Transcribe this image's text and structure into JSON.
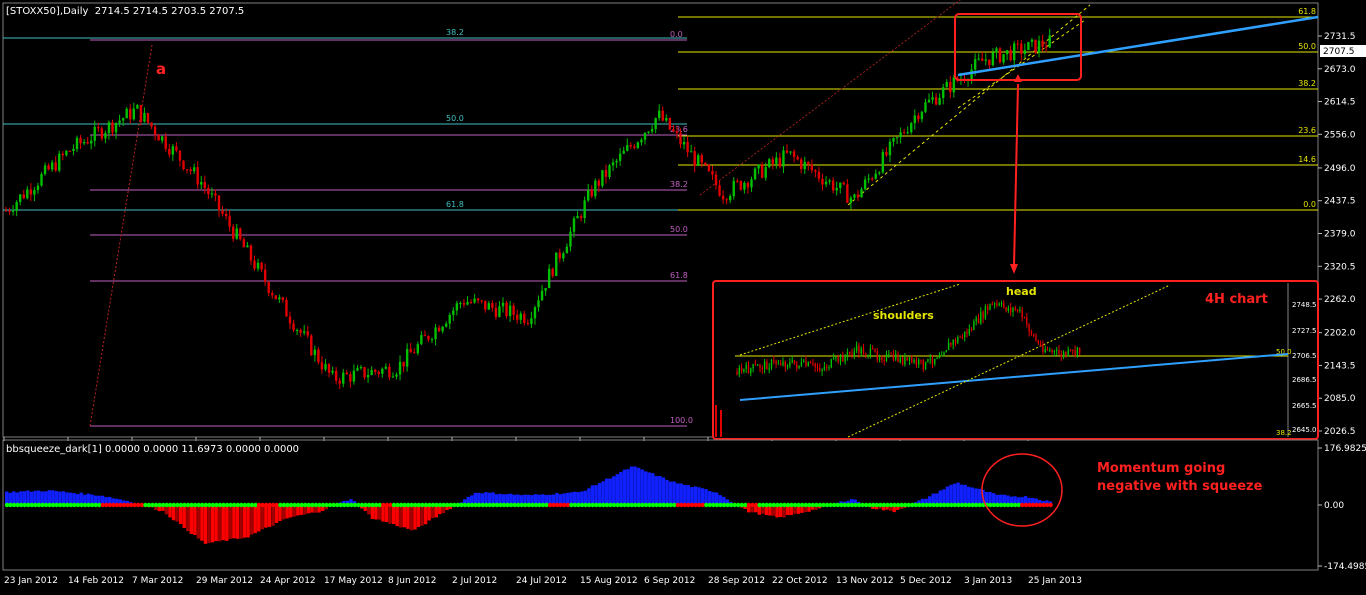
{
  "header": {
    "symbol_text": "[STOXX50],Daily",
    "ohlc_text": "2714.5 2714.5 2703.5 2707.5"
  },
  "indicator_header": {
    "text": "bbsqueeze_dark[1] 0.0000 0.0000 11.6973 0.0000 0.0000"
  },
  "colors": {
    "background": "#000000",
    "bull": "#00c000",
    "bear": "#e00000",
    "fib_yellow": "#e6e600",
    "fib_violet": "#c060c0",
    "fib_cyan": "#40c0c0",
    "trendline": "#30a0ff",
    "annotation_red": "#ff2020",
    "momentum_blue": "#1020ff",
    "momentum_red": "#ff0000",
    "squeeze_green": "#00ff00",
    "squeeze_red": "#ff0000"
  },
  "chart_data": [
    {
      "type": "candlestick",
      "title": "[STOXX50],Daily",
      "ylim": [
        2000,
        2800
      ],
      "y_ticks": [
        "2731.5",
        "2673.0",
        "2614.5",
        "2556.0",
        "2496.0",
        "2437.5",
        "2379.0",
        "2320.5",
        "2262.0",
        "2202.0",
        "2143.5",
        "2085.0",
        "2026.5"
      ],
      "current_price": "2707.5",
      "x_ticks": [
        "23 Jan 2012",
        "14 Feb 2012",
        "7 Mar 2012",
        "29 Mar 2012",
        "24 Apr 2012",
        "17 May 2012",
        "8 Jun 2012",
        "2 Jul 2012",
        "24 Jul 2012",
        "15 Aug 2012",
        "6 Sep 2012",
        "28 Sep 2012",
        "22 Oct 2012",
        "13 Nov 2012",
        "5 Dec 2012",
        "3 Jan 2013",
        "25 Jan 2013"
      ],
      "close_path": [
        [
          "23 Jan 2012",
          2420
        ],
        [
          "14 Feb 2012",
          2530
        ],
        [
          "7 Mar 2012",
          2600
        ],
        [
          "29 Mar 2012",
          2470
        ],
        [
          "24 Apr 2012",
          2290
        ],
        [
          "17 May 2012",
          2120
        ],
        [
          "8 Jun 2012",
          2140
        ],
        [
          "2 Jul 2012",
          2260
        ],
        [
          "24 Jul 2012",
          2230
        ],
        [
          "15 Aug 2012",
          2460
        ],
        [
          "6 Sep 2012",
          2590
        ],
        [
          "28 Sep 2012",
          2450
        ],
        [
          "22 Oct 2012",
          2520
        ],
        [
          "13 Nov 2012",
          2440
        ],
        [
          "5 Dec 2012",
          2600
        ],
        [
          "3 Jan 2013",
          2690
        ],
        [
          "25 Jan 2013",
          2720
        ]
      ],
      "fib_levels_right": [
        "61.8",
        "50.0",
        "38.2",
        "23.6",
        "14.6",
        "0.0"
      ],
      "fib_levels_violet": [
        "0.0",
        "23.6",
        "38.2",
        "50.0",
        "61.8",
        "100.0"
      ],
      "fib_levels_cyan": [
        "38.2",
        "50.0",
        "61.8"
      ],
      "annotations": {
        "wave_label": "a",
        "momentum_note": "Momentum going negative with squeeze"
      }
    },
    {
      "type": "candlestick",
      "title": "4H chart",
      "y_ticks": [
        "2748.5",
        "2727.5",
        "2706.5",
        "2686.5",
        "2665.5",
        "2645.0"
      ],
      "current_price": "2706.5",
      "fib_labels": [
        "50.0",
        "38.2"
      ],
      "annotations": [
        "head",
        "shoulders"
      ]
    },
    {
      "type": "bar",
      "title": "bbsqueeze_dark[1]",
      "y_ticks": [
        "176.9825",
        "0.00",
        "-174.4985"
      ],
      "ylim": [
        -174.4985,
        176.9825
      ]
    }
  ]
}
